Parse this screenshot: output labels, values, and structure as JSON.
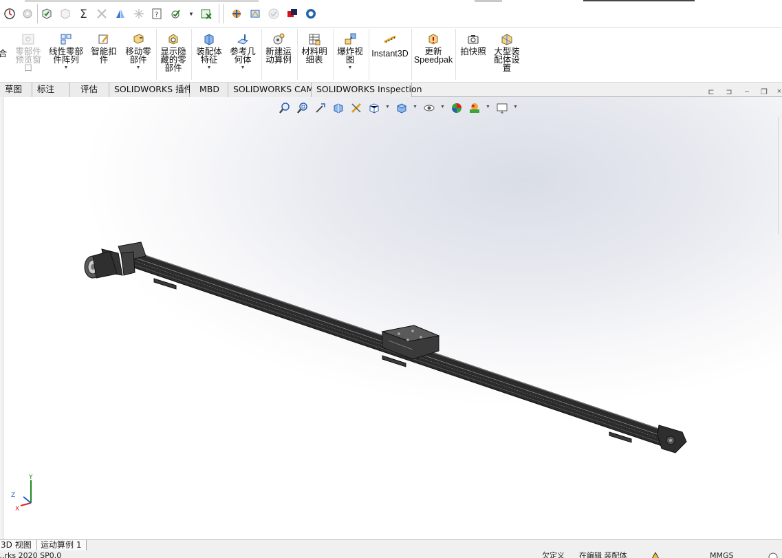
{
  "ribbon": {
    "items": [
      {
        "label": "合",
        "disabled": false,
        "icon": "assembly-icon"
      },
      {
        "label": "零部件\n预览窗\n口",
        "disabled": true,
        "icon": "preview-window-icon"
      },
      {
        "label": "线性零部\n件阵列",
        "disabled": false,
        "icon": "linear-pattern-icon"
      },
      {
        "label": "智能扣\n件",
        "disabled": false,
        "icon": "smart-fastener-icon"
      },
      {
        "label": "移动零\n部件",
        "disabled": false,
        "icon": "move-component-icon"
      },
      {
        "label": "显示隐\n藏的零\n部件",
        "disabled": false,
        "icon": "show-hidden-icon"
      },
      {
        "label": "装配体\n特征",
        "disabled": false,
        "icon": "assembly-feature-icon"
      },
      {
        "label": "参考几\n何体",
        "disabled": false,
        "icon": "reference-geometry-icon"
      },
      {
        "label": "新建运\n动算例",
        "disabled": false,
        "icon": "motion-study-icon"
      },
      {
        "label": "材料明\n细表",
        "disabled": false,
        "icon": "bill-of-materials-icon"
      },
      {
        "label": "爆炸视\n图",
        "disabled": false,
        "icon": "exploded-view-icon"
      },
      {
        "label": "Instant3D",
        "disabled": false,
        "icon": "instant3d-icon"
      },
      {
        "label": "更新\nSpeedpak",
        "disabled": false,
        "icon": "speedpak-icon"
      },
      {
        "label": "拍快照",
        "disabled": false,
        "icon": "snapshot-icon"
      },
      {
        "label": "大型装\n配体设\n置",
        "disabled": false,
        "icon": "large-assembly-icon"
      }
    ]
  },
  "tabs": [
    "草图",
    "标注",
    "评估",
    "SOLIDWORKS 插件",
    "MBD",
    "SOLIDWORKS CAM",
    "SOLIDWORKS Inspection"
  ],
  "model_tabs": [
    "3D 视图",
    "运动算例 1"
  ],
  "status": {
    "version": "...rks 2020 SP0.0",
    "defined": "欠定义",
    "editing": "在编辑 装配体",
    "units": "MMGS"
  },
  "triad": {
    "x": "X",
    "y": "Y",
    "z": "Z"
  },
  "colors": {
    "model": "#2b2b2b",
    "accent": "#1e6fd0",
    "background_center": "#d9dde6"
  }
}
